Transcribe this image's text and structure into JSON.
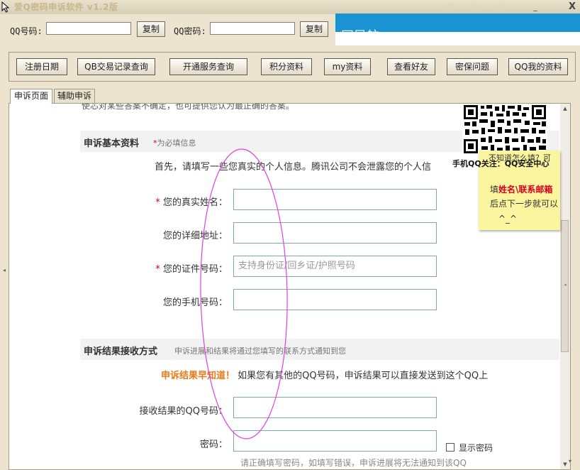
{
  "window": {
    "title": "爱Q密码申诉软件 v1.2版",
    "minimize_glyph": "_",
    "close_glyph": "X"
  },
  "credentials": {
    "qq_label": "QQ号码:",
    "qq_value": "",
    "password_label": "QQ密码:",
    "password_value": "",
    "copy_label": "复制"
  },
  "banner": {
    "color": "#1a93d2",
    "ghost_text": "网导航"
  },
  "toolbar": {
    "buttons": [
      "注册日期",
      "QB交易记录查询",
      "开通服务查询",
      "积分资料",
      "my资料",
      "查看好友",
      "密保问题",
      "QQ我的资料"
    ]
  },
  "tabs": [
    {
      "label": "申诉页面",
      "active": true
    },
    {
      "label": "辅助申诉",
      "active": false
    }
  ],
  "page": {
    "top_cut_text": "使芯对某些答案不确定，也可提供您认为最正确的答案。",
    "section1": {
      "title": "申诉基本资料",
      "required_star": "*",
      "note": "为必填信息"
    },
    "intro": "首先，请填写一些您真实的个人信息。腾讯公司不会泄露您的个人信",
    "fields": [
      {
        "label": "您的真实姓名：",
        "required": true,
        "placeholder": ""
      },
      {
        "label": "您的详细地址：",
        "required": false,
        "placeholder": ""
      },
      {
        "label": "您的证件号码：",
        "required": true,
        "placeholder": "支持身份证/回乡证/护照号码"
      },
      {
        "label": "您的手机号码：",
        "required": false,
        "placeholder": ""
      }
    ],
    "section2": {
      "title": "申诉结果接收方式",
      "note": "申诉进展和结果将通过您填写的联系方式通知到您"
    },
    "notice_highlight": "申诉结果早知道！",
    "notice_text": "如果您有其他的QQ号码，申诉结果可以直接发送到这个QQ上",
    "receive_qq_label": "接收结果的QQ号码：",
    "password_label": "密码：",
    "show_password_label": "显示密码",
    "bottom_hint": "请正确填写密码，如填写错误，申诉进展将无法通知到该QQ"
  },
  "sticky_note": {
    "line1": "不知道怎么填？可",
    "line2_prefix": "填",
    "line2_highlight": "姓名\\联系邮箱",
    "line3": "后点下一步就可以",
    "line4": "^_^"
  },
  "qr": {
    "caption": "手机QQ关注：QQ安全中心"
  },
  "annotation_color": "#e040e0"
}
